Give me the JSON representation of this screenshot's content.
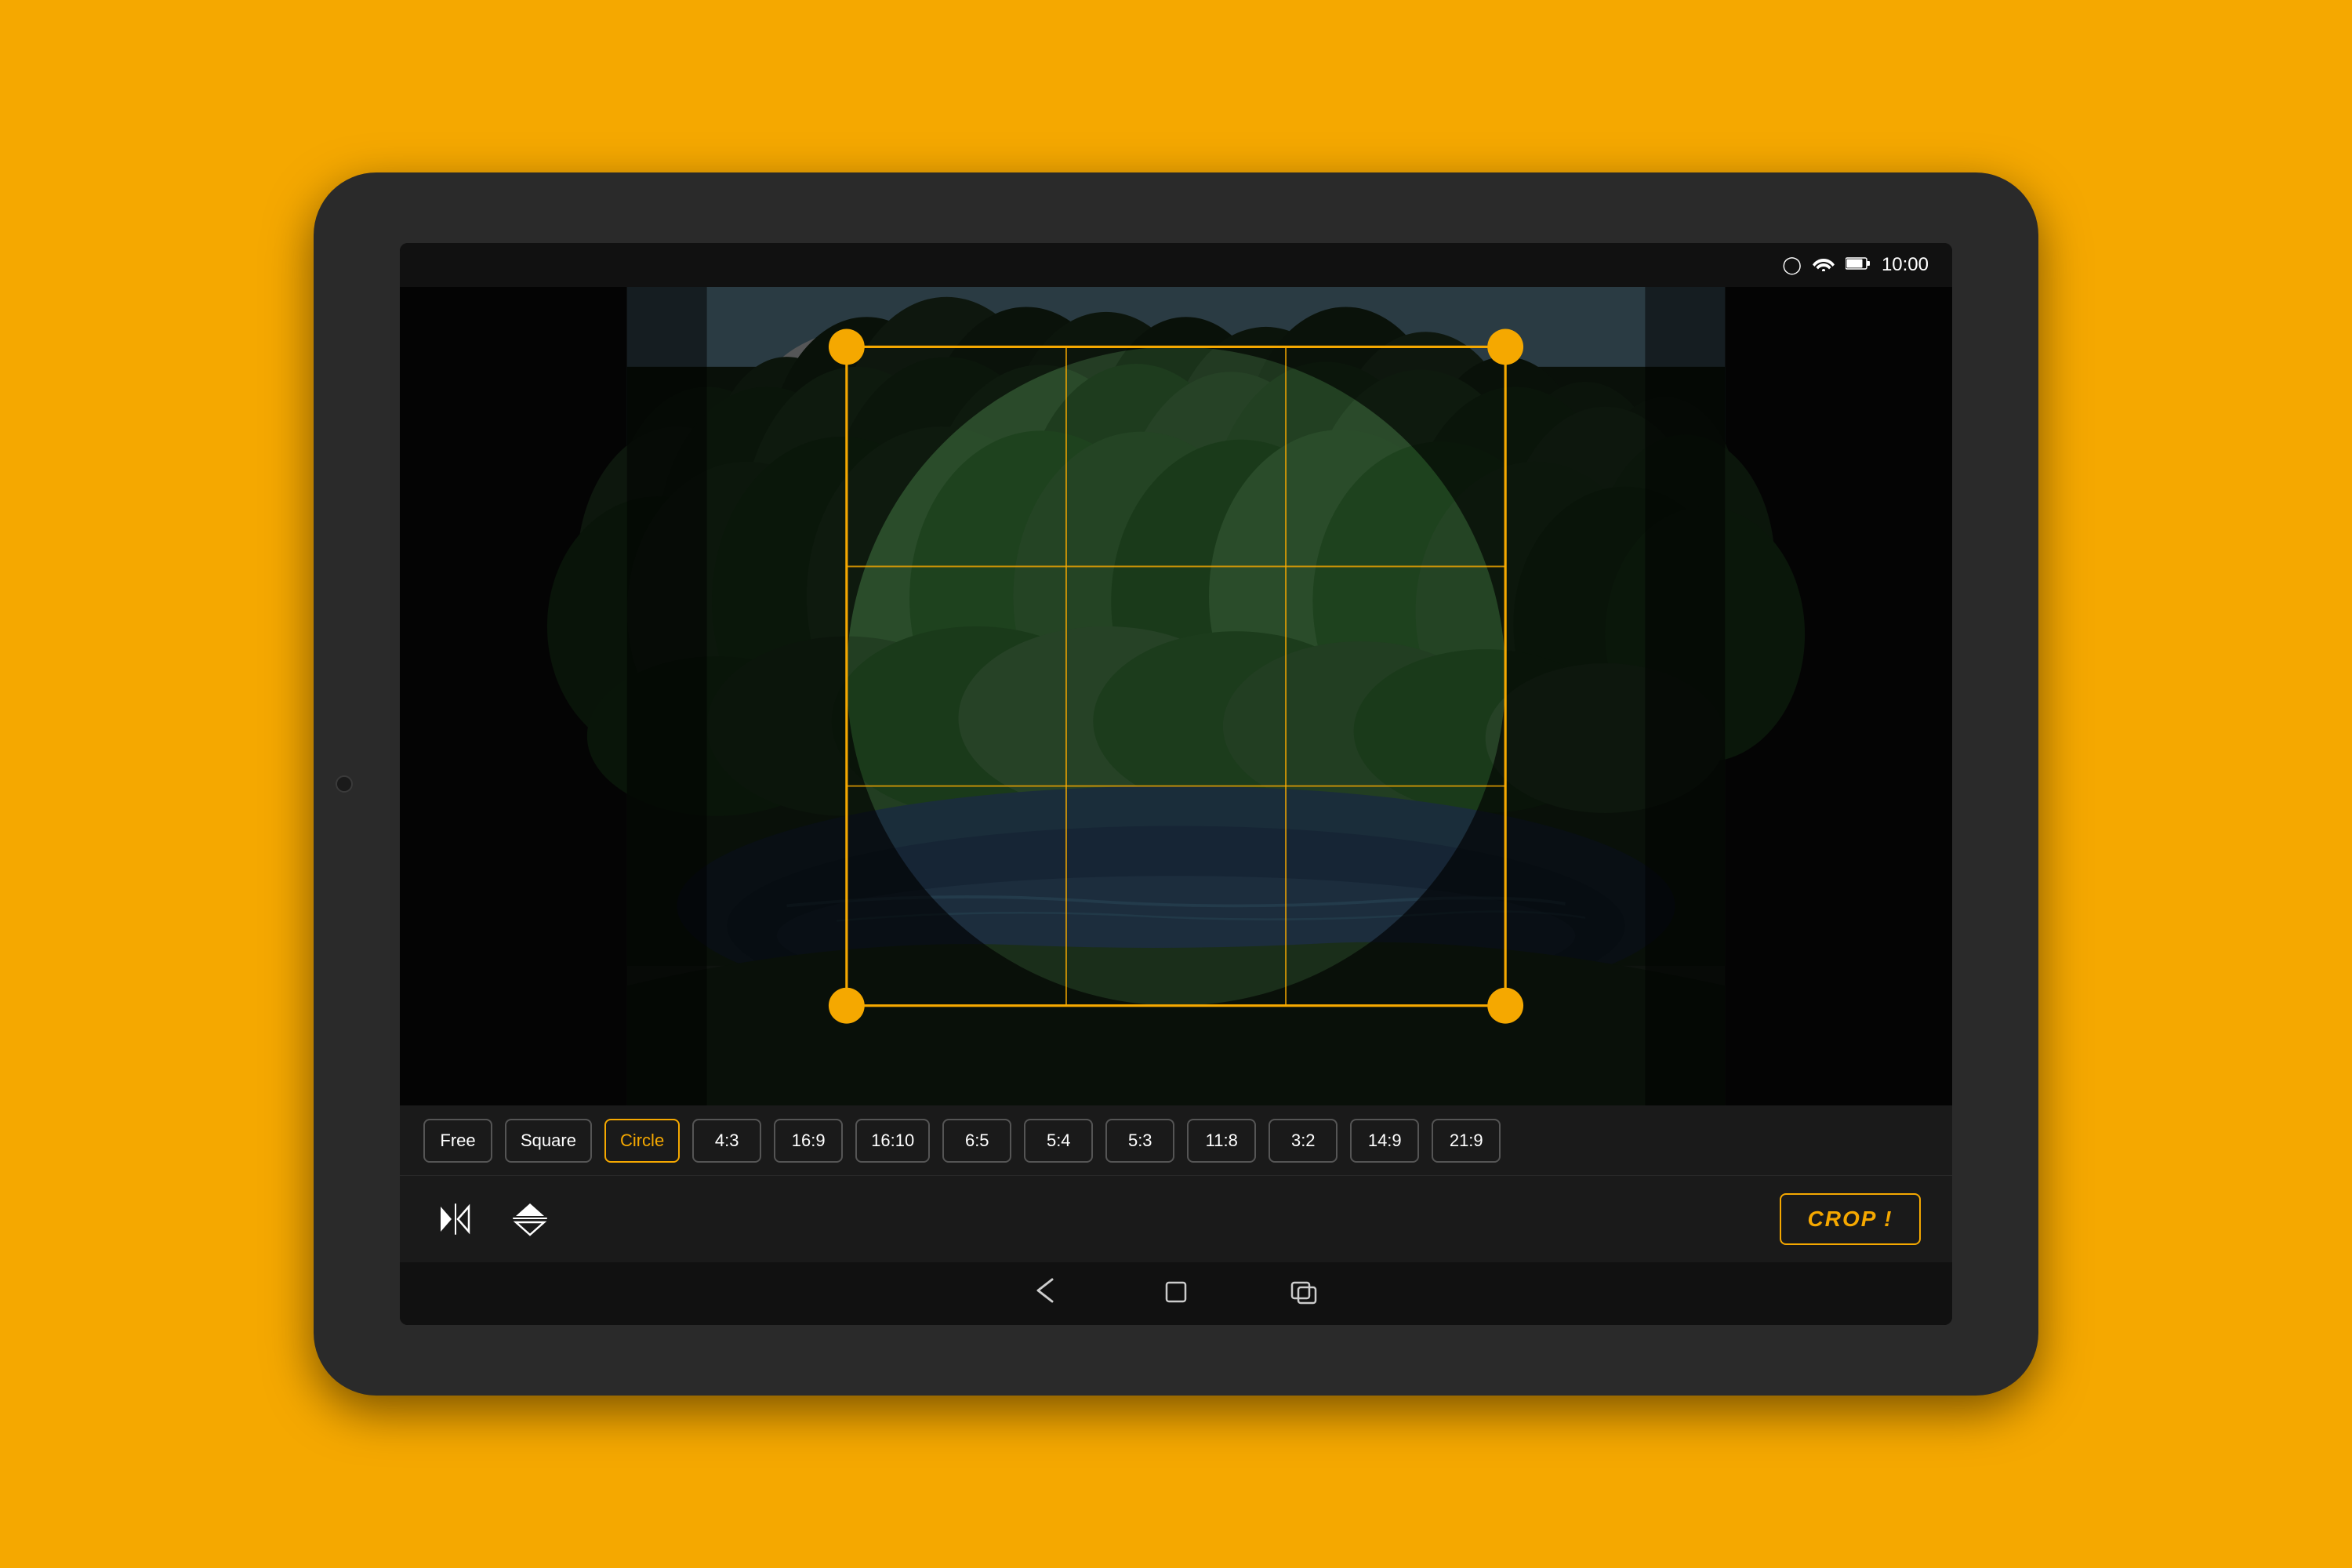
{
  "background_color": "#F5A800",
  "status_bar": {
    "time": "10:00",
    "icons": [
      "alarm",
      "wifi",
      "battery"
    ]
  },
  "ratio_buttons": [
    {
      "label": "Free",
      "active": false
    },
    {
      "label": "Square",
      "active": false
    },
    {
      "label": "Circle",
      "active": true
    },
    {
      "label": "4:3",
      "active": false
    },
    {
      "label": "16:9",
      "active": false
    },
    {
      "label": "16:10",
      "active": false
    },
    {
      "label": "6:5",
      "active": false
    },
    {
      "label": "5:4",
      "active": false
    },
    {
      "label": "5:3",
      "active": false
    },
    {
      "label": "11:8",
      "active": false
    },
    {
      "label": "3:2",
      "active": false
    },
    {
      "label": "14:9",
      "active": false
    },
    {
      "label": "21:9",
      "active": false
    }
  ],
  "crop_button": {
    "label": "CROP !"
  },
  "accent_color": "#F5A800",
  "nav_icons": [
    "back",
    "home",
    "recents"
  ]
}
